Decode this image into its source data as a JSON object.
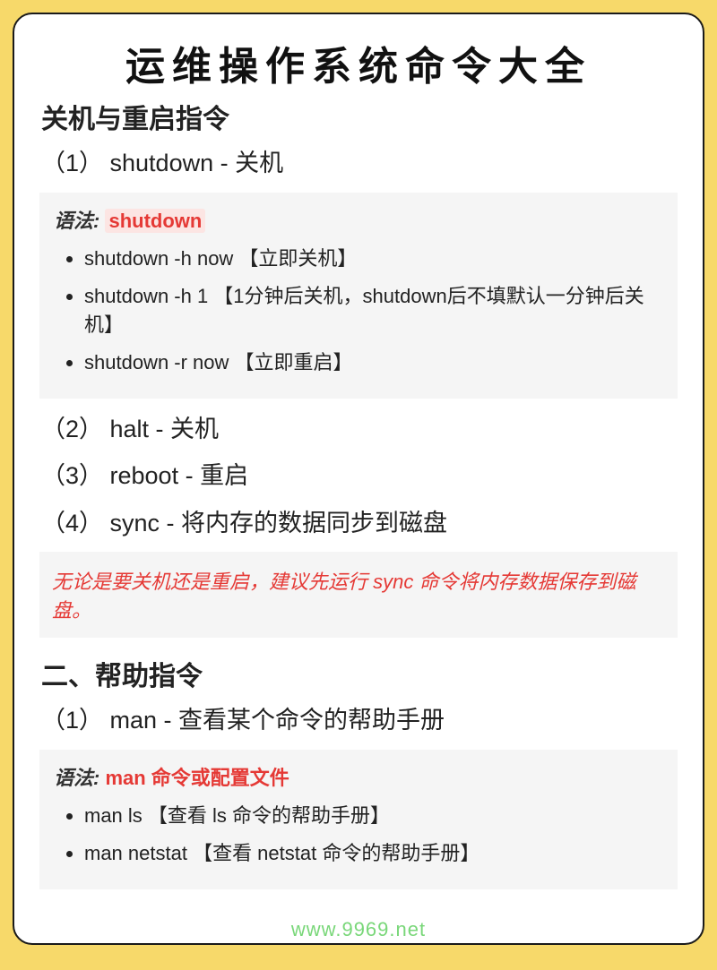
{
  "title": "运维操作系统命令大全",
  "section1": {
    "heading": "关机与重启指令",
    "items": [
      {
        "label": "（1） shutdown - 关机"
      },
      {
        "label": "（2） halt - 关机"
      },
      {
        "label": "（3） reboot - 重启"
      },
      {
        "label": "（4） sync - 将内存的数据同步到磁盘"
      }
    ],
    "syntax_label": "语法: ",
    "syntax_cmd": "shutdown",
    "bullets": [
      "shutdown -h now 【立即关机】",
      "shutdown -h 1 【1分钟后关机，shutdown后不填默认一分钟后关机】",
      "shutdown -r now 【立即重启】"
    ],
    "note": "无论是要关机还是重启，建议先运行 sync 命令将内存数据保存到磁盘。"
  },
  "section2": {
    "heading": "二、帮助指令",
    "items": [
      {
        "label": "（1） man - 查看某个命令的帮助手册"
      }
    ],
    "syntax_label": "语法: ",
    "syntax_cmd": "man 命令或配置文件",
    "bullets": [
      "man ls 【查看 ls 命令的帮助手册】",
      "man netstat 【查看 netstat 命令的帮助手册】"
    ]
  },
  "watermark": "www.9969.net"
}
